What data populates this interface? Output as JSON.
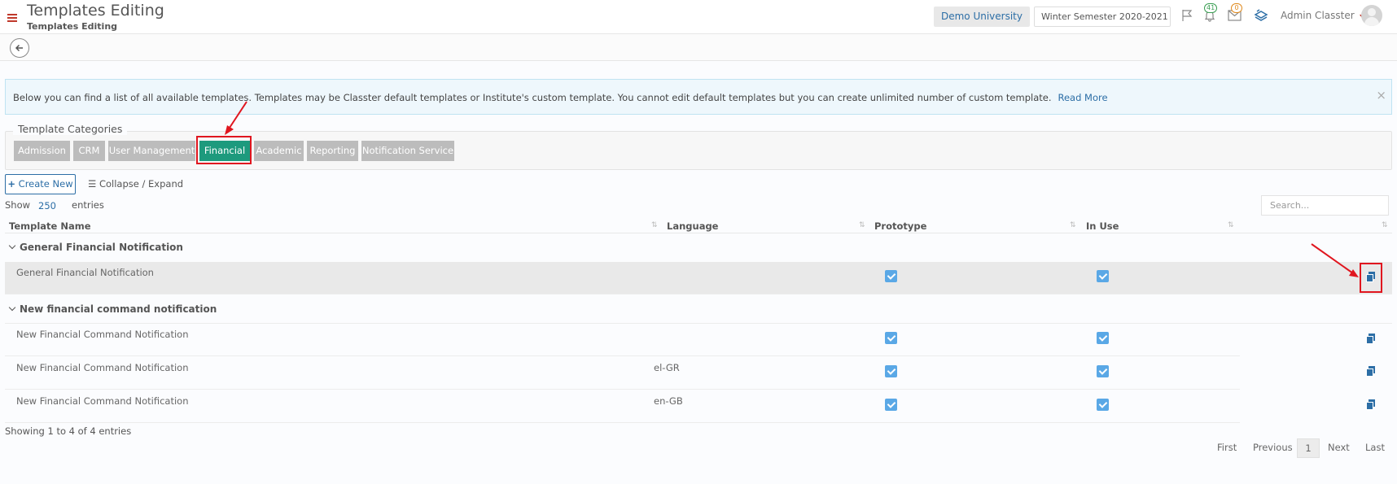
{
  "header": {
    "title": "Templates Editing",
    "subtitle": "Templates Editing",
    "university": "Demo University",
    "semester": "Winter Semester 2020-2021",
    "notifications_count": "41",
    "messages_count": "0",
    "user": "Admin Classter"
  },
  "info": {
    "text": "Below you can find a list of all available templates. Templates may be Classter default templates or Institute's custom template. You cannot edit default templates but you can create unlimited number of custom template.",
    "read_more": "Read More",
    "close": "×"
  },
  "categories": {
    "legend": "Template Categories",
    "tabs": [
      "Admission",
      "CRM",
      "User Management",
      "Financial",
      "Academic",
      "Reporting",
      "Notification Service"
    ],
    "active": "Financial"
  },
  "toolbar": {
    "create_new": "Create New",
    "collapse_expand": "Collapse / Expand",
    "show": "Show",
    "page_size": "250",
    "entries": "entries",
    "search_placeholder": "Search..."
  },
  "table": {
    "columns": [
      "Template Name",
      "Language",
      "Prototype",
      "In Use"
    ],
    "groups": [
      {
        "name": "General Financial Notification",
        "rows": [
          {
            "name": "General Financial Notification",
            "language": "",
            "prototype": true,
            "in_use": true
          }
        ]
      },
      {
        "name": "New financial command notification",
        "rows": [
          {
            "name": "New Financial Command Notification",
            "language": "",
            "prototype": true,
            "in_use": true
          },
          {
            "name": "New Financial Command Notification",
            "language": "el-GR",
            "prototype": true,
            "in_use": true
          },
          {
            "name": "New Financial Command Notification",
            "language": "en-GB",
            "prototype": true,
            "in_use": true
          }
        ]
      }
    ]
  },
  "footer": {
    "info": "Showing 1 to 4 of 4 entries",
    "pagination": {
      "first": "First",
      "previous": "Previous",
      "current": "1",
      "next": "Next",
      "last": "Last"
    }
  },
  "colors": {
    "accent": "#2c6ea6",
    "active_tab": "#1d9a7d",
    "highlight": "#e0161f",
    "checkbox": "#5aa8e6"
  }
}
